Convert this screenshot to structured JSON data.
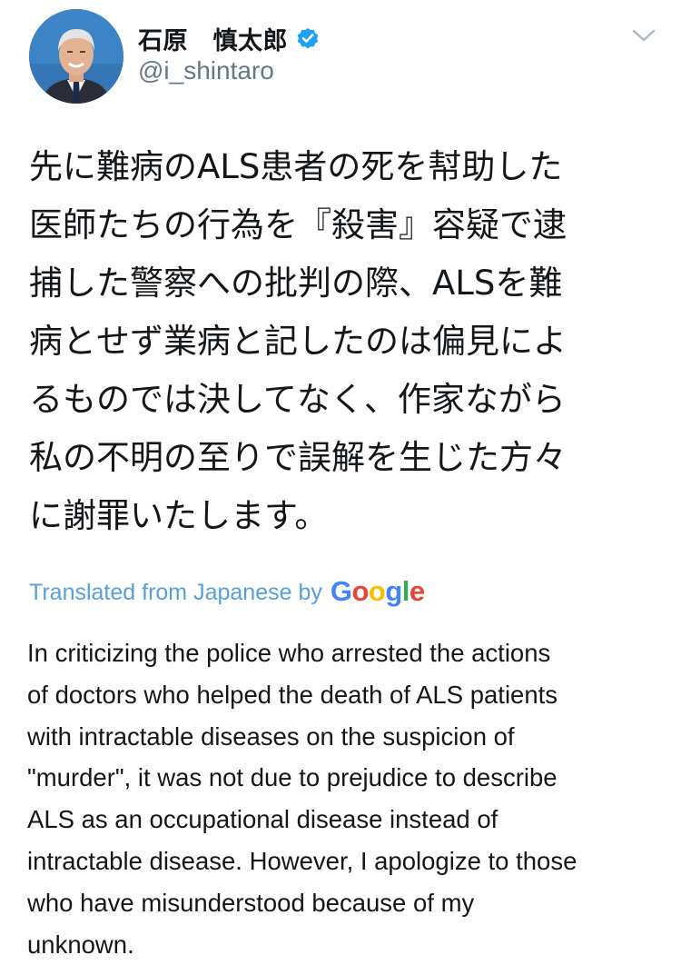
{
  "tweet": {
    "display_name": "石原　慎太郎",
    "handle": "@i_shintaro",
    "verified": true,
    "text_lines": [
      "先に難病のALS患者の死を幇助した",
      "医師たちの行為を『殺害』容疑で逮",
      "捕した警察への批判の際、ALSを難",
      "病とせず業病と記したのは偏見によ",
      "るものでは決してなく、作家ながら",
      "私の不明の至りで誤解を生じた方々",
      "に謝罪いたします。"
    ],
    "translation": {
      "label": "Translated from Japanese by",
      "provider_logo": {
        "letters": [
          "G",
          "o",
          "o",
          "g",
          "l",
          "e"
        ],
        "colors": [
          "#4285F4",
          "#EA4335",
          "#FBBC05",
          "#4285F4",
          "#34A853",
          "#EA4335"
        ]
      },
      "lines": [
        "In criticizing the police who arrested the actions",
        "of doctors who helped the death of ALS patients",
        "with intractable diseases on the suspicion of",
        "\"murder\", it was not due to prejudice to describe",
        "ALS as an occupational disease instead of",
        "intractable disease. However, I apologize to those",
        "who have misunderstood because of my",
        "unknown."
      ]
    }
  },
  "icons": {
    "verified": "verified-badge-icon",
    "menu": "chevron-down-icon",
    "avatar": "profile-photo"
  },
  "colors": {
    "text": "#14171a",
    "secondary": "#657786",
    "link": "#55a0d8",
    "verified": "#1da1f2"
  }
}
